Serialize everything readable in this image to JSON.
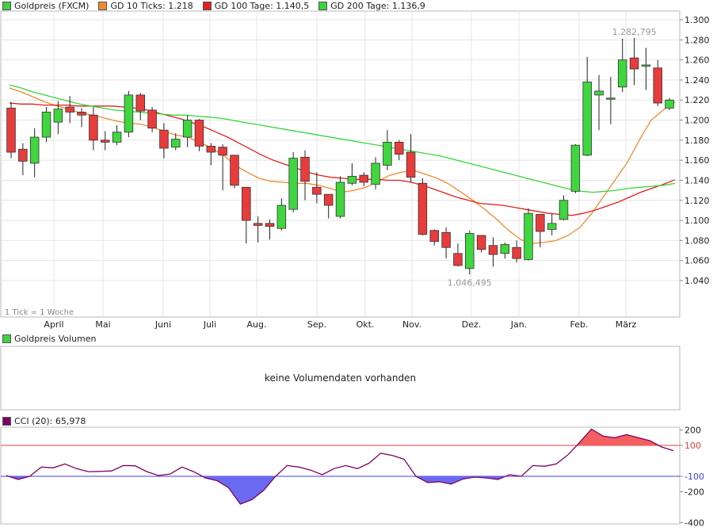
{
  "legend": {
    "main": [
      {
        "label": "Goldpreis (FXCM)",
        "color": "#3fcf3f"
      },
      {
        "label": "GD 10 Ticks: 1.218",
        "color": "#f08a30"
      },
      {
        "label": "GD 100 Tage: 1.140,5",
        "color": "#e02020"
      },
      {
        "label": "GD 200 Tage: 1.136,9",
        "color": "#3ad43a"
      }
    ],
    "volume": {
      "label": "Goldpreis Volumen",
      "color": "#3fcf3f"
    },
    "cci": {
      "label": "CCI (20): 65,978",
      "color": "#800060"
    }
  },
  "volume_message": "keine Volumendaten vorhanden",
  "tick_note": "1 Tick = 1 Woche",
  "annotations": {
    "high": "1.282,795",
    "low": "1.046,495"
  },
  "chart_data": [
    {
      "type": "candlestick",
      "title": "Goldpreis (FXCM)",
      "x_axis_labels": [
        "April",
        "Mai",
        "Juni",
        "Juli",
        "Aug.",
        "Sep.",
        "Okt.",
        "Nov.",
        "Dez.",
        "Jan.",
        "Feb.",
        "März"
      ],
      "y_tick_labels": [
        "1.040",
        "1.060",
        "1.080",
        "1.100",
        "1.120",
        "1.140",
        "1.160",
        "1.180",
        "1.200",
        "1.220",
        "1.240",
        "1.260",
        "1.280",
        "1.300"
      ],
      "ylim": [
        1020,
        1310
      ],
      "grid": true,
      "colors": {
        "up": "#3fd63f",
        "down": "#e83c3c"
      },
      "candles": [
        {
          "o": 1212,
          "h": 1218,
          "l": 1162,
          "c": 1168
        },
        {
          "o": 1171,
          "h": 1177,
          "l": 1145,
          "c": 1159
        },
        {
          "o": 1157,
          "h": 1192,
          "l": 1143,
          "c": 1183
        },
        {
          "o": 1183,
          "h": 1213,
          "l": 1178,
          "c": 1208
        },
        {
          "o": 1198,
          "h": 1219,
          "l": 1186,
          "c": 1211
        },
        {
          "o": 1213,
          "h": 1224,
          "l": 1197,
          "c": 1208
        },
        {
          "o": 1208,
          "h": 1212,
          "l": 1193,
          "c": 1205
        },
        {
          "o": 1205,
          "h": 1213,
          "l": 1170,
          "c": 1180
        },
        {
          "o": 1180,
          "h": 1189,
          "l": 1170,
          "c": 1178
        },
        {
          "o": 1178,
          "h": 1195,
          "l": 1175,
          "c": 1188
        },
        {
          "o": 1188,
          "h": 1229,
          "l": 1183,
          "c": 1225
        },
        {
          "o": 1225,
          "h": 1227,
          "l": 1200,
          "c": 1209
        },
        {
          "o": 1210,
          "h": 1213,
          "l": 1188,
          "c": 1192
        },
        {
          "o": 1190,
          "h": 1197,
          "l": 1162,
          "c": 1172
        },
        {
          "o": 1173,
          "h": 1187,
          "l": 1170,
          "c": 1181
        },
        {
          "o": 1183,
          "h": 1205,
          "l": 1173,
          "c": 1200
        },
        {
          "o": 1200,
          "h": 1201,
          "l": 1169,
          "c": 1174
        },
        {
          "o": 1174,
          "h": 1177,
          "l": 1155,
          "c": 1168
        },
        {
          "o": 1173,
          "h": 1176,
          "l": 1130,
          "c": 1165
        },
        {
          "o": 1165,
          "h": 1165,
          "l": 1132,
          "c": 1135
        },
        {
          "o": 1133,
          "h": 1133,
          "l": 1077,
          "c": 1100
        },
        {
          "o": 1097,
          "h": 1104,
          "l": 1078,
          "c": 1095
        },
        {
          "o": 1097,
          "h": 1101,
          "l": 1081,
          "c": 1094
        },
        {
          "o": 1092,
          "h": 1122,
          "l": 1090,
          "c": 1115
        },
        {
          "o": 1111,
          "h": 1168,
          "l": 1108,
          "c": 1162
        },
        {
          "o": 1163,
          "h": 1170,
          "l": 1120,
          "c": 1139
        },
        {
          "o": 1133,
          "h": 1148,
          "l": 1117,
          "c": 1126
        },
        {
          "o": 1126,
          "h": 1125,
          "l": 1102,
          "c": 1115
        },
        {
          "o": 1104,
          "h": 1144,
          "l": 1102,
          "c": 1138
        },
        {
          "o": 1137,
          "h": 1157,
          "l": 1135,
          "c": 1144
        },
        {
          "o": 1145,
          "h": 1148,
          "l": 1134,
          "c": 1138
        },
        {
          "o": 1136,
          "h": 1163,
          "l": 1131,
          "c": 1157
        },
        {
          "o": 1155,
          "h": 1190,
          "l": 1150,
          "c": 1178
        },
        {
          "o": 1178,
          "h": 1180,
          "l": 1160,
          "c": 1166
        },
        {
          "o": 1168,
          "h": 1186,
          "l": 1138,
          "c": 1143
        },
        {
          "o": 1137,
          "h": 1142,
          "l": 1085,
          "c": 1086
        },
        {
          "o": 1090,
          "h": 1091,
          "l": 1075,
          "c": 1079
        },
        {
          "o": 1088,
          "h": 1093,
          "l": 1062,
          "c": 1073
        },
        {
          "o": 1067,
          "h": 1077,
          "l": 1054,
          "c": 1055
        },
        {
          "o": 1052,
          "h": 1090,
          "l": 1046,
          "c": 1087
        },
        {
          "o": 1085,
          "h": 1083,
          "l": 1068,
          "c": 1071
        },
        {
          "o": 1075,
          "h": 1083,
          "l": 1054,
          "c": 1066
        },
        {
          "o": 1067,
          "h": 1078,
          "l": 1062,
          "c": 1076
        },
        {
          "o": 1073,
          "h": 1080,
          "l": 1058,
          "c": 1062
        },
        {
          "o": 1061,
          "h": 1112,
          "l": 1060,
          "c": 1107
        },
        {
          "o": 1106,
          "h": 1104,
          "l": 1073,
          "c": 1089
        },
        {
          "o": 1091,
          "h": 1107,
          "l": 1085,
          "c": 1097
        },
        {
          "o": 1101,
          "h": 1125,
          "l": 1100,
          "c": 1120
        },
        {
          "o": 1129,
          "h": 1176,
          "l": 1127,
          "c": 1175
        },
        {
          "o": 1165,
          "h": 1263,
          "l": 1164,
          "c": 1238
        },
        {
          "o": 1225,
          "h": 1245,
          "l": 1190,
          "c": 1229
        },
        {
          "o": 1222,
          "h": 1243,
          "l": 1196,
          "c": 1222
        },
        {
          "o": 1233,
          "h": 1281,
          "l": 1228,
          "c": 1260
        },
        {
          "o": 1262,
          "h": 1282,
          "l": 1235,
          "c": 1251
        },
        {
          "o": 1255,
          "h": 1272,
          "l": 1230,
          "c": 1255
        },
        {
          "o": 1252,
          "h": 1260,
          "l": 1214,
          "c": 1217
        },
        {
          "o": 1212,
          "h": 1222,
          "l": 1210,
          "c": 1220
        }
      ],
      "series": [
        {
          "name": "GD 10 Ticks",
          "color": "#f08a30",
          "values": [
            1232,
            1228,
            1223,
            1218,
            1214,
            1211,
            1207,
            1205,
            1202,
            1199,
            1197,
            1196,
            1193,
            1189,
            1185,
            1183,
            1178,
            1172,
            1165,
            1155,
            1148,
            1142,
            1139,
            1138,
            1137,
            1137,
            1135,
            1132,
            1128,
            1130,
            1133,
            1139,
            1145,
            1148,
            1150,
            1146,
            1142,
            1136,
            1128,
            1120,
            1111,
            1101,
            1090,
            1081,
            1077,
            1078,
            1080,
            1085,
            1093,
            1107,
            1124,
            1141,
            1158,
            1180,
            1200,
            1210,
            1218
          ]
        },
        {
          "name": "GD 100 Tage",
          "color": "#e02020",
          "values": [
            1217,
            1216,
            1216,
            1215,
            1215,
            1215,
            1214,
            1214,
            1214,
            1214,
            1213,
            1212,
            1210,
            1207,
            1204,
            1201,
            1197,
            1193,
            1188,
            1183,
            1177,
            1171,
            1165,
            1160,
            1156,
            1152,
            1148,
            1145,
            1143,
            1142,
            1141,
            1141,
            1141,
            1140,
            1140,
            1138,
            1135,
            1131,
            1127,
            1123,
            1120,
            1117,
            1116,
            1115,
            1113,
            1111,
            1109,
            1107,
            1106,
            1105,
            1107,
            1110,
            1114,
            1118,
            1123,
            1128,
            1132,
            1136,
            1140.5
          ]
        },
        {
          "name": "GD 200 Tage",
          "color": "#3ad43a",
          "values": [
            1235,
            1232,
            1228,
            1225,
            1222,
            1219,
            1216,
            1214,
            1212,
            1210,
            1209,
            1208,
            1207,
            1206,
            1205,
            1205,
            1204,
            1203,
            1202,
            1200,
            1198,
            1196,
            1194,
            1192,
            1190,
            1188,
            1186,
            1184,
            1182,
            1180,
            1178,
            1176,
            1174,
            1172,
            1170,
            1168,
            1166,
            1164,
            1161,
            1158,
            1155,
            1152,
            1149,
            1146,
            1143,
            1140,
            1137,
            1134,
            1131,
            1129,
            1128,
            1129,
            1130,
            1132,
            1133,
            1134,
            1135,
            1136.9
          ]
        }
      ]
    },
    {
      "type": "line",
      "title": "CCI (20)",
      "y_tick_labels": [
        "-400",
        "-200",
        "-100",
        "100",
        "200"
      ],
      "ylim": [
        -400,
        200
      ],
      "thresholds": [
        100,
        -100
      ],
      "fill_colors": {
        "above": "#f46060",
        "below": "#6a6af0"
      },
      "series": [
        {
          "name": "CCI (20)",
          "color": "#800060",
          "values": [
            -95,
            -120,
            -100,
            -40,
            -45,
            -20,
            -50,
            -70,
            -68,
            -65,
            -30,
            -32,
            -70,
            -95,
            -85,
            -40,
            -70,
            -110,
            -128,
            -175,
            -280,
            -250,
            -190,
            -100,
            -30,
            -40,
            -60,
            -90,
            -50,
            -30,
            -50,
            -15,
            50,
            35,
            10,
            -100,
            -140,
            -135,
            -150,
            -118,
            -105,
            -110,
            -120,
            -90,
            -100,
            -30,
            -35,
            -20,
            40,
            120,
            205,
            160,
            150,
            170,
            150,
            130,
            90,
            65.978
          ]
        }
      ]
    }
  ]
}
